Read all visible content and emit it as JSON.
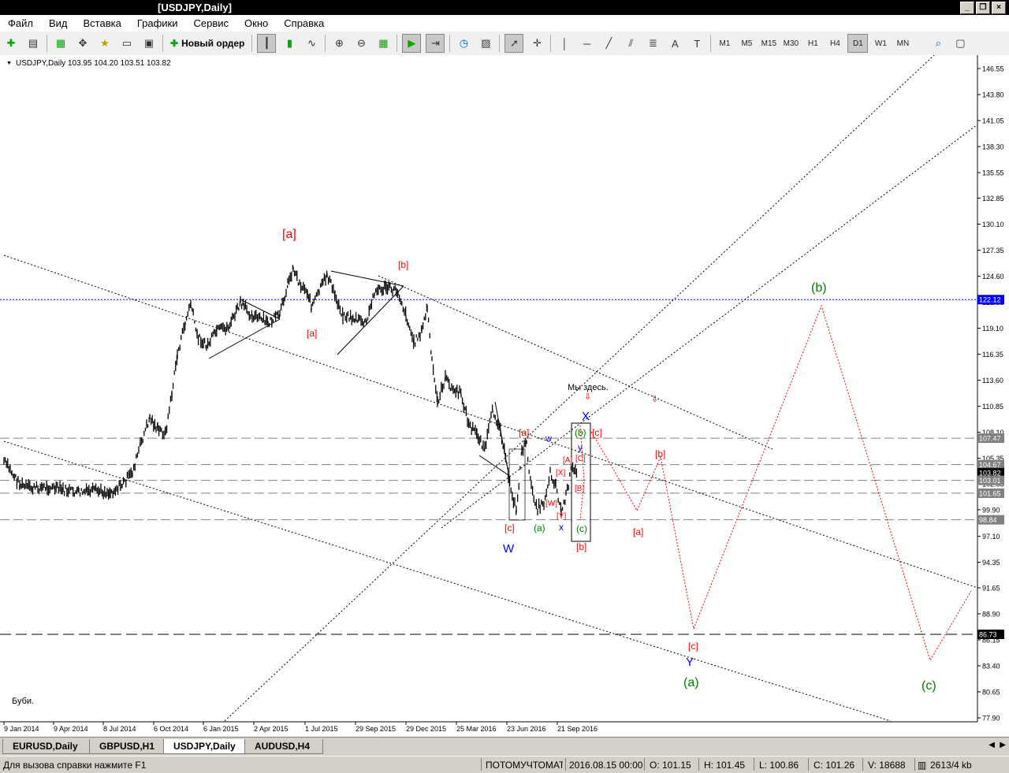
{
  "window": {
    "title": "[USDJPY,Daily]"
  },
  "menu": [
    "Файл",
    "Вид",
    "Вставка",
    "Графики",
    "Сервис",
    "Окно",
    "Справка"
  ],
  "toolbar": {
    "new_order": "Новый ордер",
    "timeframes": [
      "M1",
      "M5",
      "M15",
      "M30",
      "H1",
      "H4",
      "D1",
      "W1",
      "MN"
    ],
    "active_timeframe": "D1"
  },
  "chart": {
    "header": "USDJPY,Daily  103.95 104.20 103.51 103.82",
    "note": "Буби.",
    "here_label": "Мы здесь.",
    "price_labels": [
      "146.55",
      "143.80",
      "141.05",
      "138.30",
      "135.55",
      "132.85",
      "130.10",
      "127.35",
      "124.60",
      "121.85",
      "119.10",
      "116.35",
      "113.60",
      "110.85",
      "108.10",
      "105.35",
      "102.65",
      "99.90",
      "97.10",
      "94.35",
      "91.65",
      "88.90",
      "86.15",
      "83.40",
      "80.65",
      "77.90"
    ],
    "level_labels": [
      {
        "label": "122.12",
        "color": "#0000ff"
      },
      {
        "label": "107.47",
        "color": "#808080"
      },
      {
        "label": "104.67",
        "color": "#808080"
      },
      {
        "label": "103.82",
        "color": "#000000"
      },
      {
        "label": "103.01",
        "color": "#808080"
      },
      {
        "label": "101.65",
        "color": "#808080"
      },
      {
        "label": "98.84",
        "color": "#808080"
      },
      {
        "label": "86.73",
        "color": "#000000"
      }
    ],
    "dates": [
      "9 Jan 2014",
      "9 Apr 2014",
      "8 Jul 2014",
      "6 Oct 2014",
      "6 Jan 2015",
      "2 Apr 2015",
      "1 Jul 2015",
      "29 Sep 2015",
      "29 Dec 2015",
      "25 Mar 2016",
      "23 Jun 2016",
      "21 Sep 2016"
    ],
    "wave_labels": [
      {
        "t": "[a]",
        "c": "#ff0000"
      },
      {
        "t": "[b]",
        "c": "#ff0000"
      },
      {
        "t": "[a]",
        "c": "#ff0000"
      },
      {
        "t": "(b)",
        "c": "#008000"
      },
      {
        "t": "[a]",
        "c": "#ff0000"
      },
      {
        "t": "[c]",
        "c": "#ff0000"
      },
      {
        "t": "W",
        "c": "#0000ff"
      },
      {
        "t": "(a)",
        "c": "#008000"
      },
      {
        "t": "w",
        "c": "#0000ff"
      },
      {
        "t": "x",
        "c": "#0000ff"
      },
      {
        "t": "[X]",
        "c": "#ff0000"
      },
      {
        "t": "[W]",
        "c": "#ff0000"
      },
      {
        "t": "[Y]",
        "c": "#ff0000"
      },
      {
        "t": "[A]",
        "c": "#ff0000"
      },
      {
        "t": "[B]",
        "c": "#ff0000"
      },
      {
        "t": "[C]",
        "c": "#ff0000"
      },
      {
        "t": "(b)",
        "c": "#008000"
      },
      {
        "t": "y",
        "c": "#0000ff"
      },
      {
        "t": "(c)",
        "c": "#008000"
      },
      {
        "t": "[b]",
        "c": "#ff0000"
      },
      {
        "t": "X",
        "c": "#0000ff"
      },
      {
        "t": "[c]",
        "c": "#ff0000"
      },
      {
        "t": "[b]",
        "c": "#ff0000"
      },
      {
        "t": "[a]",
        "c": "#ff0000"
      },
      {
        "t": "[c]",
        "c": "#ff0000"
      },
      {
        "t": "Y",
        "c": "#0000ff"
      },
      {
        "t": "(a)",
        "c": "#008000"
      },
      {
        "t": "(c)",
        "c": "#008000"
      }
    ]
  },
  "tabs": [
    "EURUSD,Daily",
    "GBPUSD,H1",
    "USDJPY,Daily",
    "AUDUSD,H4"
  ],
  "active_tab": 2,
  "status": {
    "help": "Для вызова справки нажмите F1",
    "profile": "ПОТОМУЧТОМАТЕ",
    "datetime": "2016.08.15 00:00",
    "open": "O: 101.15",
    "high": "H: 101.45",
    "low": "L: 100.86",
    "close": "C: 101.26",
    "volume": "V: 18688",
    "traffic": "2613/4 kb"
  }
}
